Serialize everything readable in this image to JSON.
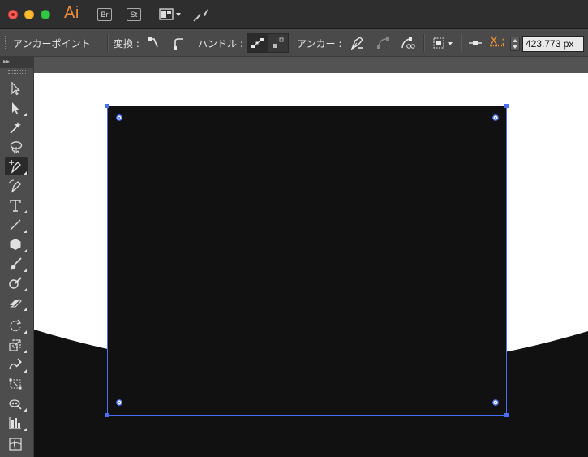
{
  "titlebar": {
    "app_logo": "Ai",
    "bridge_button": "Br",
    "stock_button": "St",
    "workspace_icon": "workspace-layout-icon",
    "gpu_icon": "gpu-performance-icon"
  },
  "controlbar": {
    "tool_name": "アンカーポイント",
    "convert_label": "変換 :",
    "handle_label": "ハンドル :",
    "anchor_label": "アンカー :",
    "x_label": "X :",
    "x_value": "423.773 px",
    "colors": {
      "accent_orange": "#f0932b"
    }
  },
  "tools": [
    "selection-tool-icon",
    "direct-selection-tool-icon",
    "magic-wand-tool-icon",
    "lasso-tool-icon",
    "add-anchor-point-pen-tool-icon",
    "curvature-pen-tool-icon",
    "type-tool-icon",
    "line-segment-tool-icon",
    "polygon-tool-icon",
    "paintbrush-tool-icon",
    "blob-brush-tool-icon",
    "eraser-tool-icon",
    "rotate-tool-icon",
    "scale-tool-icon",
    "warp-tool-icon",
    "free-transform-tool-icon",
    "symbol-sprayer-tool-icon",
    "column-graph-tool-icon",
    "mesh-tool-icon"
  ],
  "canvas": {
    "artboard_color": "#ffffff",
    "shape_fill": "#111111",
    "selection_color": "#4a6ef5"
  }
}
